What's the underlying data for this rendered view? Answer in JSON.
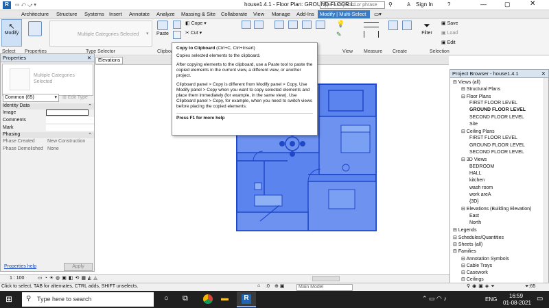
{
  "title_bar": {
    "title": "house1.4.1 - Floor Plan: GROUND FLOOR L...",
    "search_placeholder": "Type a keyword or phrase",
    "sign_in": "Sign In"
  },
  "ribbon_tabs": [
    "Architecture",
    "Structure",
    "Systems",
    "Insert",
    "Annotate",
    "Analyze",
    "Massing & Site",
    "Collaborate",
    "View",
    "Manage",
    "Add-Ins",
    "Modify | Multi-Select"
  ],
  "ribbon": {
    "modify_label": "Modify",
    "select_label": "Select",
    "properties_label": "Properties",
    "type_selector_text": "Multiple Categories Selected",
    "type_selector_panel": "Type Selector",
    "paste_label": "Paste",
    "cope_label": "Cope",
    "cut_label": "Cut",
    "clipboard_label": "Clipboard",
    "view_label": "View",
    "measure_label": "Measure",
    "create_label": "Create",
    "filter_label": "Filter",
    "selection_label": "Selection",
    "save_label": "Save",
    "load_label": "Load",
    "edit_label": "Edit"
  },
  "view_tab": "Elevations",
  "tooltip": {
    "heading": "Copy to Clipboard",
    "shortcut": " (Ctrl+C, Ctrl+Insert)",
    "p1": "Copies selected elements to the clipboard.",
    "p2": "After copying elements to the clipboard, use a Paste tool to paste the copied elements in the current view, a different view, or another project.",
    "p3": "Clipboard panel > Copy is different from Modify panel > Copy. Use Modify panel > Copy when you want to copy selected elements and place them immediately (for example, in the same view). Use Clipboard panel > Copy, for example, when you need to switch views before placing the copied elements.",
    "p4": "Press F1 for more help"
  },
  "properties": {
    "title": "Properties",
    "type_text": "Multiple Categories Selected",
    "filter_value": "Common (65)",
    "edit_type": "Edit Type",
    "identity_data": "Identity Data",
    "image_label": "Image",
    "comments_label": "Comments",
    "mark_label": "Mark",
    "phasing": "Phasing",
    "phase_created_label": "Phase Created",
    "phase_created_value": "New Construction",
    "phase_demolished_label": "Phase Demolished",
    "phase_demolished_value": "None",
    "help_link": "Properties help",
    "apply": "Apply"
  },
  "project_browser": {
    "title": "Project Browser - house1.4.1",
    "items": [
      {
        "label": "Views (all)",
        "level": 0
      },
      {
        "label": "Structural Plans",
        "level": 1
      },
      {
        "label": "Floor Plans",
        "level": 1
      },
      {
        "label": "FIRST FLOOR LEVEL",
        "level": 2
      },
      {
        "label": "GROUND FLOOR LEVEL",
        "level": 2
      },
      {
        "label": "SECOND FLOOR LEVEL",
        "level": 2
      },
      {
        "label": "Site",
        "level": 2
      },
      {
        "label": "Ceiling Plans",
        "level": 1
      },
      {
        "label": "FIRST FLOOR LEVEL",
        "level": 2
      },
      {
        "label": "GROUND FLOOR LEVEL",
        "level": 2
      },
      {
        "label": "SECOND FLOOR LEVEL",
        "level": 2
      },
      {
        "label": "3D Views",
        "level": 1
      },
      {
        "label": "BEDROOM",
        "level": 2
      },
      {
        "label": "HALL",
        "level": 2
      },
      {
        "label": "kitchen",
        "level": 2
      },
      {
        "label": "wash room",
        "level": 2
      },
      {
        "label": "work areA",
        "level": 2
      },
      {
        "label": "{3D}",
        "level": 2
      },
      {
        "label": "Elevations (Building Elevation)",
        "level": 1
      },
      {
        "label": "East",
        "level": 2
      },
      {
        "label": "North",
        "level": 2
      },
      {
        "label": "Legends",
        "level": 0
      },
      {
        "label": "Schedules/Quantities",
        "level": 0
      },
      {
        "label": "Sheets (all)",
        "level": 0
      },
      {
        "label": "Families",
        "level": 0
      },
      {
        "label": "Annotation Symbols",
        "level": 1
      },
      {
        "label": "Cable Trays",
        "level": 1
      },
      {
        "label": "Casework",
        "level": 1
      },
      {
        "label": "Ceilings",
        "level": 1
      }
    ]
  },
  "view_control": {
    "scale": "1 : 100"
  },
  "status": {
    "hint": "Click to select, TAB for alternates, CTRL adds, SHIFT unselects.",
    "zero": ":0",
    "model": "Main Model"
  },
  "taskbar": {
    "search_placeholder": "Type here to search",
    "time": "16:59",
    "date": "01-08-2021",
    "lang": "ENG"
  },
  "colors": {
    "selection": "#3f6fe8",
    "accent": "#3b7cc4"
  }
}
